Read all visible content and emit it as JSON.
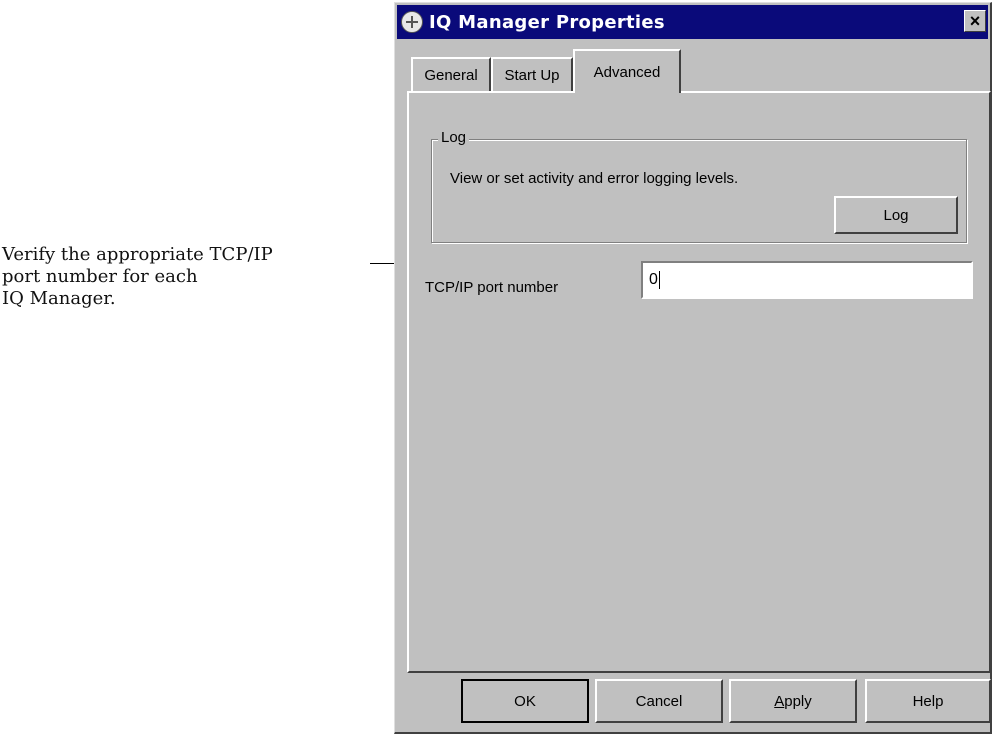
{
  "callout": {
    "lines": [
      "Verify the appropriate TCP/IP",
      "port number for each",
      "IQ Manager."
    ]
  },
  "window": {
    "title": "IQ Manager Properties",
    "close_glyph": "×"
  },
  "tabs": [
    {
      "label": "General",
      "active": false
    },
    {
      "label": "Start Up",
      "active": false
    },
    {
      "label": "Advanced",
      "active": true
    }
  ],
  "log_group": {
    "title": "Log",
    "description": "View or set activity and error logging levels.",
    "button_label": "Log"
  },
  "port": {
    "label": "TCP/IP port number",
    "value": "0"
  },
  "buttons": {
    "ok": "OK",
    "cancel": "Cancel",
    "apply_mnemonic": "A",
    "apply_rest": "pply",
    "help": "Help"
  },
  "colors": {
    "titlebar": "#0a0a7a",
    "dialog_face": "#c0c0c0"
  },
  "icons": {
    "window": "globe-icon",
    "close": "close-icon"
  }
}
